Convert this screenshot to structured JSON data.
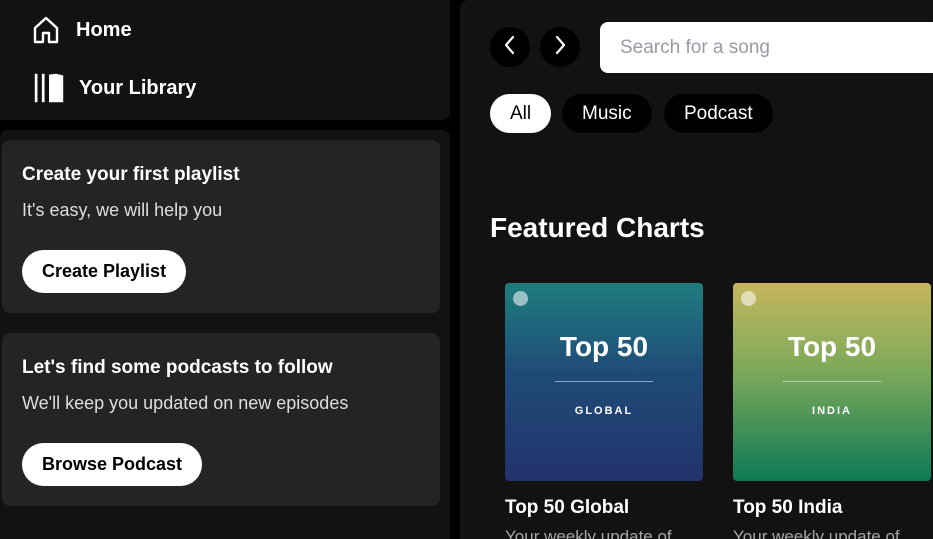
{
  "nav": {
    "home_label": "Home",
    "home_icon": "home-icon",
    "library_label": "Your Library",
    "library_icon": "library-icon"
  },
  "library": {
    "cards": [
      {
        "title": "Create your first playlist",
        "subtitle": "It's easy, we will help you",
        "button": "Create Playlist"
      },
      {
        "title": "Let's find some podcasts to follow",
        "subtitle": "We'll keep you updated on new episodes",
        "button": "Browse Podcast"
      }
    ]
  },
  "main": {
    "search_placeholder": "Search for a song",
    "filters": [
      "All",
      "Music",
      "Podcast"
    ],
    "active_filter": "All",
    "section_title": "Featured Charts",
    "charts": [
      {
        "cover_title": "Top 50",
        "cover_subtitle": "GLOBAL",
        "title": "Top 50 Global",
        "description": "Your weekly update of"
      },
      {
        "cover_title": "Top 50",
        "cover_subtitle": "INDIA",
        "title": "Top 50 India",
        "description": "Your weekly update of"
      }
    ]
  },
  "colors": {
    "background": "#000000",
    "panel": "#121212",
    "card": "#242424",
    "muted_text": "#a7a7a7"
  }
}
